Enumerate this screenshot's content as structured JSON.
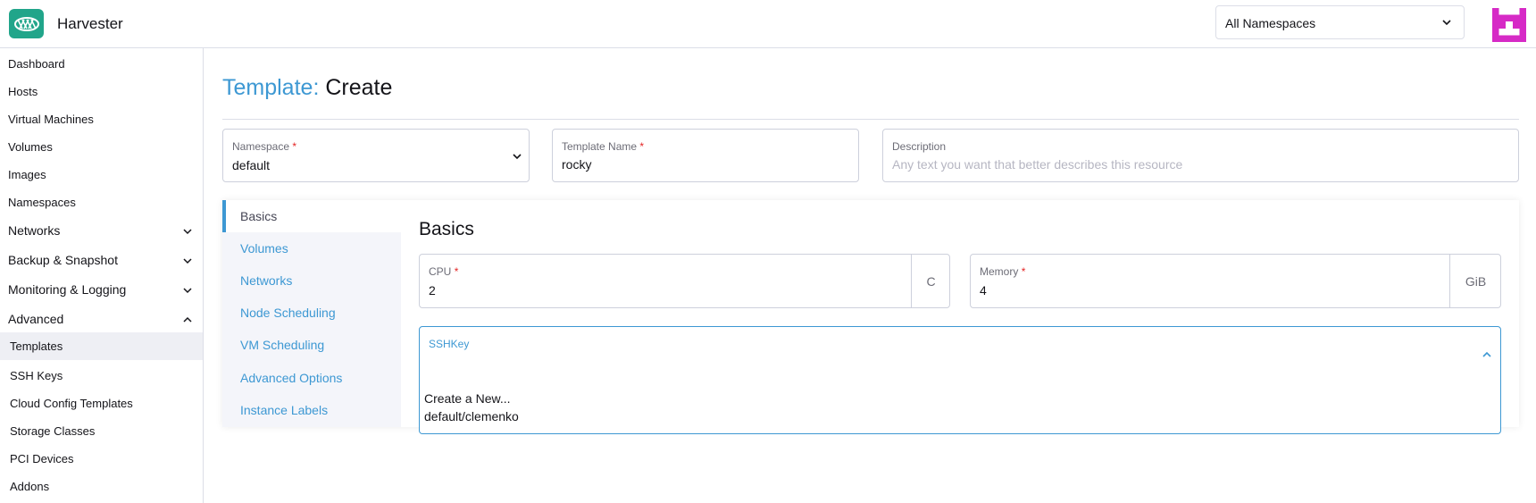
{
  "app": {
    "name": "Harvester"
  },
  "header": {
    "namespace_select": {
      "value": "All Namespaces"
    }
  },
  "sidebar": {
    "items": [
      {
        "label": "Dashboard"
      },
      {
        "label": "Hosts"
      },
      {
        "label": "Virtual Machines"
      },
      {
        "label": "Volumes"
      },
      {
        "label": "Images"
      },
      {
        "label": "Namespaces"
      }
    ],
    "groups": [
      {
        "label": "Networks",
        "expanded": false
      },
      {
        "label": "Backup & Snapshot",
        "expanded": false
      },
      {
        "label": "Monitoring & Logging",
        "expanded": false
      },
      {
        "label": "Advanced",
        "expanded": true
      }
    ],
    "advanced_items": [
      {
        "label": "Templates",
        "active": true
      },
      {
        "label": "SSH Keys"
      },
      {
        "label": "Cloud Config Templates"
      },
      {
        "label": "Storage Classes"
      },
      {
        "label": "PCI Devices"
      },
      {
        "label": "Addons"
      }
    ]
  },
  "page": {
    "title_prefix": "Template:",
    "title_action": "Create"
  },
  "form": {
    "namespace": {
      "label": "Namespace",
      "required": "*",
      "value": "default"
    },
    "template_name": {
      "label": "Template Name",
      "required": "*",
      "value": "rocky"
    },
    "description": {
      "label": "Description",
      "placeholder": "Any text you want that better describes this resource"
    }
  },
  "tabs": [
    {
      "label": "Basics",
      "active": true
    },
    {
      "label": "Volumes"
    },
    {
      "label": "Networks"
    },
    {
      "label": "Node Scheduling"
    },
    {
      "label": "VM Scheduling"
    },
    {
      "label": "Advanced Options"
    },
    {
      "label": "Instance Labels"
    }
  ],
  "basics": {
    "title": "Basics",
    "cpu": {
      "label": "CPU",
      "required": "*",
      "value": "2",
      "unit": "C"
    },
    "memory": {
      "label": "Memory",
      "required": "*",
      "value": "4",
      "unit": "GiB"
    },
    "sshkey": {
      "label": "SSHKey",
      "options": [
        "Create a New...",
        "default/clemenko"
      ]
    }
  },
  "colors": {
    "accent": "#3d98d3",
    "brand": "#21a58a",
    "required": "#e42525",
    "avatar": "#d62ac6"
  },
  "icons": {
    "logo": "harvester-logo-icon",
    "avatar": "user-avatar-icon",
    "chevron_down": "chevron-down-icon",
    "chevron_up": "chevron-up-icon"
  }
}
